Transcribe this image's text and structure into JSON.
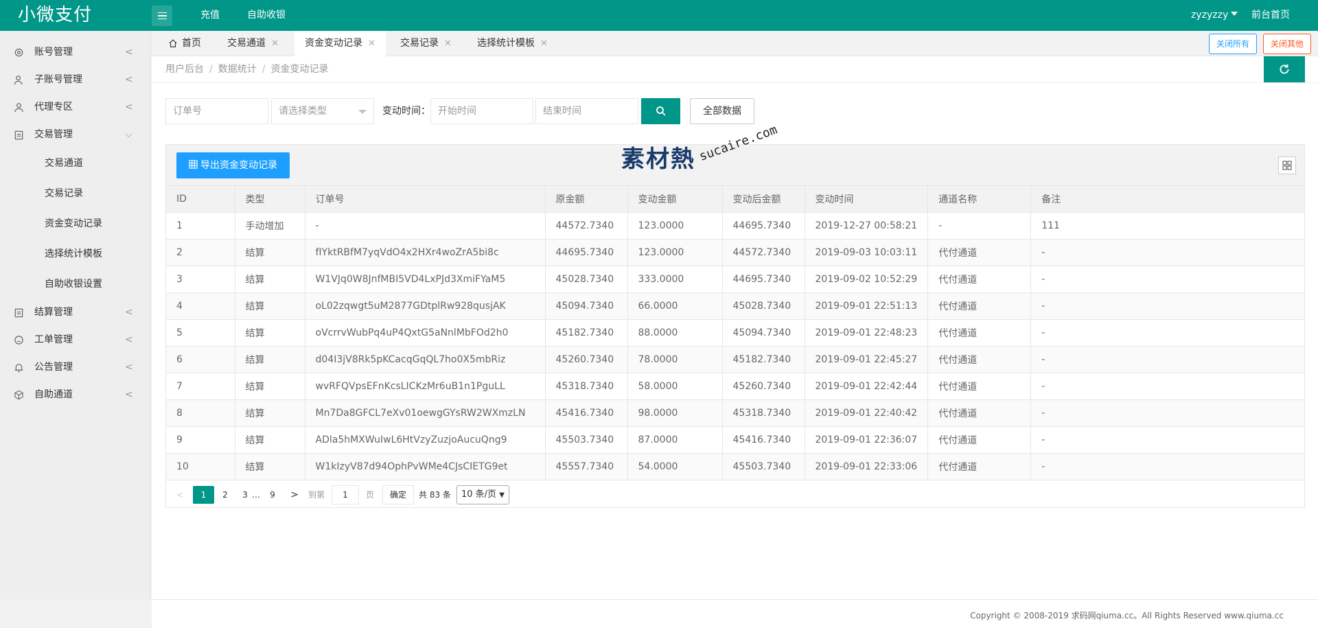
{
  "header": {
    "logo": "小微支付",
    "nav": [
      "充值",
      "自助收银"
    ],
    "user": "zyzyzzy",
    "frontpage": "前台首页"
  },
  "sidebar": {
    "items": [
      {
        "label": "账号管理",
        "icon": "gear-icon",
        "arrow": "<"
      },
      {
        "label": "子账号管理",
        "icon": "user-group-icon",
        "arrow": "<"
      },
      {
        "label": "代理专区",
        "icon": "user-icon",
        "arrow": "<"
      },
      {
        "label": "交易管理",
        "icon": "clipboard-icon",
        "arrow": "⌵"
      },
      {
        "label": "结算管理",
        "icon": "clipboard-icon",
        "arrow": "<"
      },
      {
        "label": "工单管理",
        "icon": "face-icon",
        "arrow": "<"
      },
      {
        "label": "公告管理",
        "icon": "bell-icon",
        "arrow": "<"
      },
      {
        "label": "自助通道",
        "icon": "cube-icon",
        "arrow": "<"
      }
    ],
    "subitems": [
      "交易通道",
      "交易记录",
      "资金变动记录",
      "选择统计模板",
      "自助收银设置"
    ]
  },
  "tabs": {
    "home": "首页",
    "items": [
      "交易通道",
      "资金变动记录",
      "交易记录",
      "选择统计模板"
    ],
    "close_symbol": "✕",
    "close_all": "关闭所有",
    "close_others": "关闭其他"
  },
  "breadcrumb": [
    "用户后台",
    "数据统计",
    "资金变动记录"
  ],
  "breadcrumb_sep": "/",
  "search": {
    "order_placeholder": "订单号",
    "type_placeholder": "请选择类型",
    "time_label": "变动时间：",
    "start_placeholder": "开始时间",
    "end_placeholder": "结束时间",
    "all_data": "全部数据"
  },
  "toolbar": {
    "export_label": "导出资金变动记录"
  },
  "watermark": {
    "logo": "素材熱",
    "sub": "sucaire.com"
  },
  "table": {
    "columns": [
      "ID",
      "类型",
      "订单号",
      "原金额",
      "变动金额",
      "变动后金额",
      "变动时间",
      "通道名称",
      "备注"
    ],
    "rows": [
      [
        "1",
        "手动增加",
        "-",
        "44572.7340",
        "123.0000",
        "44695.7340",
        "2019-12-27 00:58:21",
        "-",
        "111"
      ],
      [
        "2",
        "结算",
        "fIYktRBfM7yqVdO4x2HXr4woZrA5bi8c",
        "44695.7340",
        "123.0000",
        "44572.7340",
        "2019-09-03 10:03:11",
        "代付通道",
        "-"
      ],
      [
        "3",
        "结算",
        "W1VJq0W8JnfMBI5VD4LxPJd3XmiFYaM5",
        "45028.7340",
        "333.0000",
        "44695.7340",
        "2019-09-02 10:52:29",
        "代付通道",
        "-"
      ],
      [
        "4",
        "结算",
        "oL02zqwgt5uM2877GDtplRw928qusjAK",
        "45094.7340",
        "66.0000",
        "45028.7340",
        "2019-09-01 22:51:13",
        "代付通道",
        "-"
      ],
      [
        "5",
        "结算",
        "oVcrrvWubPq4uP4QxtG5aNnlMbFOd2h0",
        "45182.7340",
        "88.0000",
        "45094.7340",
        "2019-09-01 22:48:23",
        "代付通道",
        "-"
      ],
      [
        "6",
        "结算",
        "d04I3jV8Rk5pKCacqGqQL7ho0X5mbRiz",
        "45260.7340",
        "78.0000",
        "45182.7340",
        "2019-09-01 22:45:27",
        "代付通道",
        "-"
      ],
      [
        "7",
        "结算",
        "wvRFQVpsEFnKcsLICKzMr6uB1n1PguLL",
        "45318.7340",
        "58.0000",
        "45260.7340",
        "2019-09-01 22:42:44",
        "代付通道",
        "-"
      ],
      [
        "8",
        "结算",
        "Mn7Da8GFCL7eXv01oewgGYsRW2WXmzLN",
        "45416.7340",
        "98.0000",
        "45318.7340",
        "2019-09-01 22:40:42",
        "代付通道",
        "-"
      ],
      [
        "9",
        "结算",
        "ADla5hMXWuIwL6HtVzyZuzjoAucuQng9",
        "45503.7340",
        "87.0000",
        "45416.7340",
        "2019-09-01 22:36:07",
        "代付通道",
        "-"
      ],
      [
        "10",
        "结算",
        "W1kIzyV87d94OphPvWMe4CJsCIETG9et",
        "45557.7340",
        "54.0000",
        "45503.7340",
        "2019-09-01 22:33:06",
        "代付通道",
        "-"
      ]
    ]
  },
  "pager": {
    "prev": "<",
    "pages": [
      "1",
      "2",
      "3",
      "…",
      "9"
    ],
    "next": ">",
    "goto_label": "到第",
    "goto_value": "1",
    "page_label": "页",
    "confirm": "确定",
    "total": "共 83 条",
    "per_page": "10 条/页"
  },
  "footer": "Copyright © 2008-2019 求码网qiuma.cc。All Rights Reserved www.qiuma.cc",
  "colors": {
    "primary": "#009688",
    "export": "#1E9FFF",
    "close_all": "#1E9FFF",
    "close_others": "#FF5722"
  }
}
